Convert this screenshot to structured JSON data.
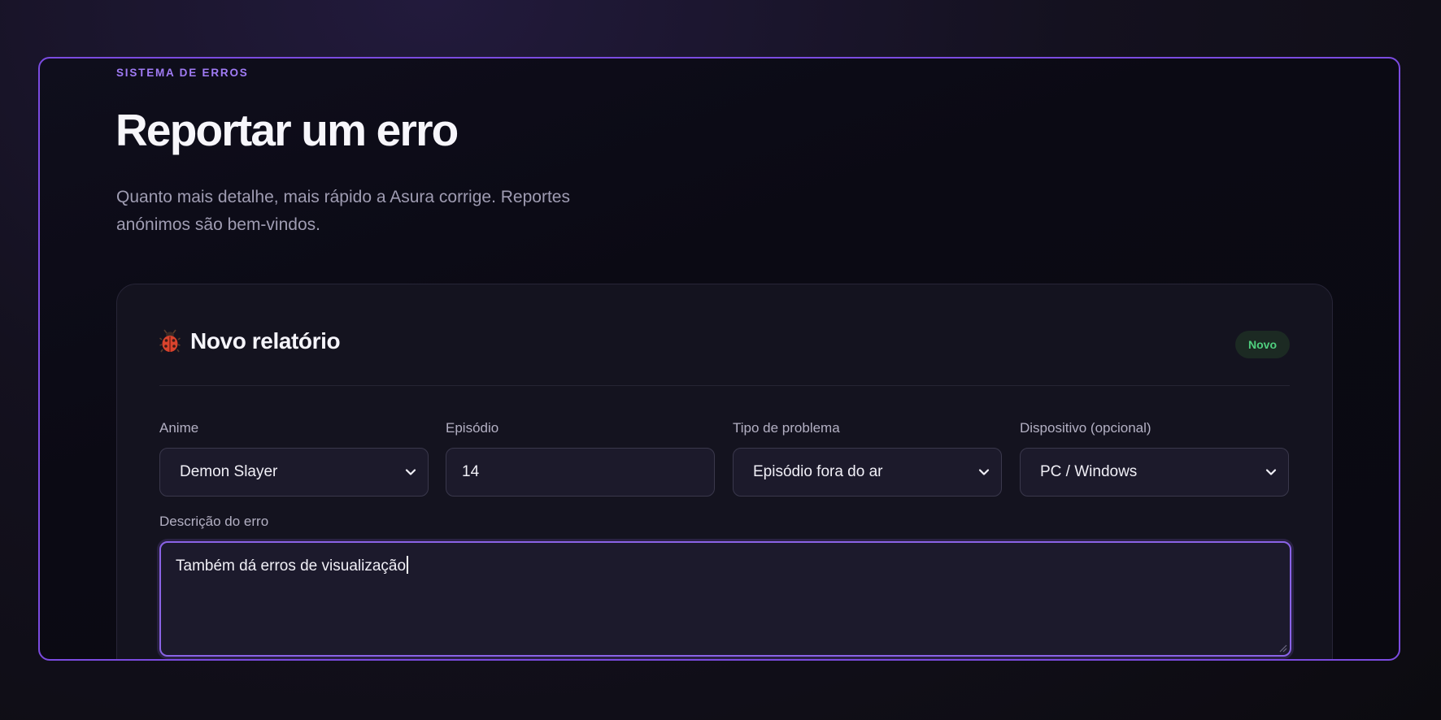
{
  "header": {
    "eyebrow": "SISTEMA DE ERROS",
    "title": "Reportar um erro",
    "subtitle": "Quanto mais detalhe, mais rápido a Asura corrige. Reportes anónimos são bem-vindos."
  },
  "card": {
    "icon": "bug-icon",
    "title": "Novo relatório",
    "badge": "Novo"
  },
  "fields": {
    "anime": {
      "label": "Anime",
      "value": "Demon Slayer",
      "icon": "chevron-down-icon"
    },
    "episode": {
      "label": "Episódio",
      "value": "14"
    },
    "problem_type": {
      "label": "Tipo de problema",
      "value": "Episódio fora do ar",
      "icon": "chevron-down-icon"
    },
    "device": {
      "label": "Dispositivo (opcional)",
      "value": "PC / Windows",
      "icon": "chevron-down-icon"
    },
    "description": {
      "label": "Descrição do erro",
      "value": "Também dá erros de visualização"
    }
  },
  "colors": {
    "accent": "#7b4be0",
    "eyebrow": "#a07bf5",
    "badge_text": "#4fcf7e",
    "badge_bg": "#1c2a23"
  }
}
